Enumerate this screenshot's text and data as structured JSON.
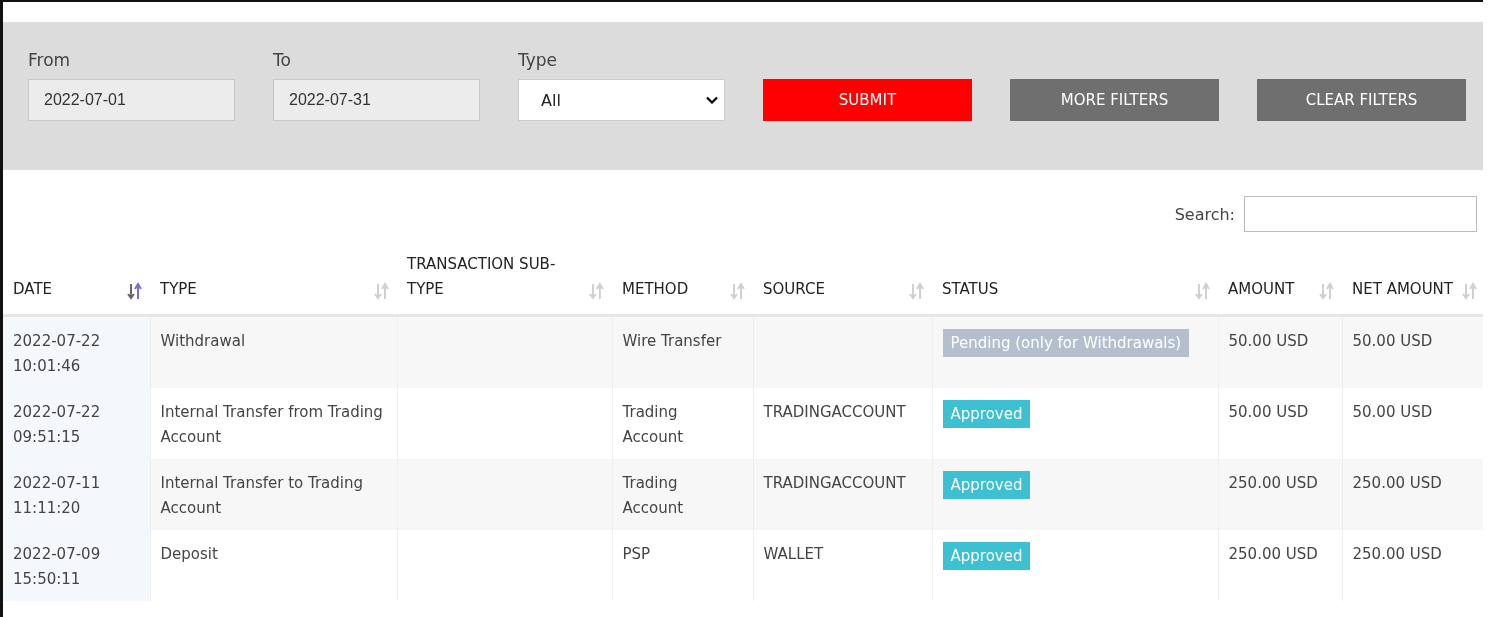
{
  "filters": {
    "from": {
      "label": "From",
      "value": "2022-07-01"
    },
    "to": {
      "label": "To",
      "value": "2022-07-31"
    },
    "type": {
      "label": "Type",
      "value": "All"
    },
    "buttons": [
      {
        "label": "SUBMIT",
        "kind": "primary"
      },
      {
        "label": "MORE FILTERS",
        "kind": "secondary"
      },
      {
        "label": "CLEAR FILTERS",
        "kind": "secondary"
      }
    ]
  },
  "search": {
    "label": "Search:"
  },
  "table": {
    "columns": [
      {
        "label": "DATE",
        "sorted": true
      },
      {
        "label": "TYPE",
        "sorted": false
      },
      {
        "label": "TRANSACTION SUB-TYPE",
        "sorted": false
      },
      {
        "label": "METHOD",
        "sorted": false
      },
      {
        "label": "SOURCE",
        "sorted": false
      },
      {
        "label": "STATUS",
        "sorted": false
      },
      {
        "label": "AMOUNT",
        "sorted": false
      },
      {
        "label": "NET AMOUNT",
        "sorted": false
      }
    ],
    "rows": [
      {
        "date": "2022-07-22 10:01:46",
        "type": "Withdrawal",
        "method": "Wire Transfer",
        "status": {
          "label": "Pending (only for Withdrawals)",
          "color": "#b4bfcd"
        },
        "amount": "50.00 USD",
        "net_amount": "50.00 USD"
      },
      {
        "date": "2022-07-22 09:51:15",
        "type": "Internal Transfer from Trading Account",
        "method": "Trading Account",
        "source": "TRADINGACCOUNT",
        "status": {
          "label": "Approved",
          "color": "#3cc0d2"
        },
        "amount": "50.00 USD",
        "net_amount": "50.00 USD"
      },
      {
        "date": "2022-07-11 11:11:20",
        "type": "Internal Transfer to Trading Account",
        "method": "Trading Account",
        "source": "TRADINGACCOUNT",
        "status": {
          "label": "Approved",
          "color": "#3cc0d2"
        },
        "amount": "250.00 USD",
        "net_amount": "250.00 USD"
      },
      {
        "date": "2022-07-09 15:50:11",
        "type": "Deposit",
        "method": "PSP",
        "source": "WALLET",
        "status": {
          "label": "Approved",
          "color": "#3cc0d2"
        },
        "amount": "250.00 USD",
        "net_amount": "250.00 USD"
      }
    ]
  }
}
